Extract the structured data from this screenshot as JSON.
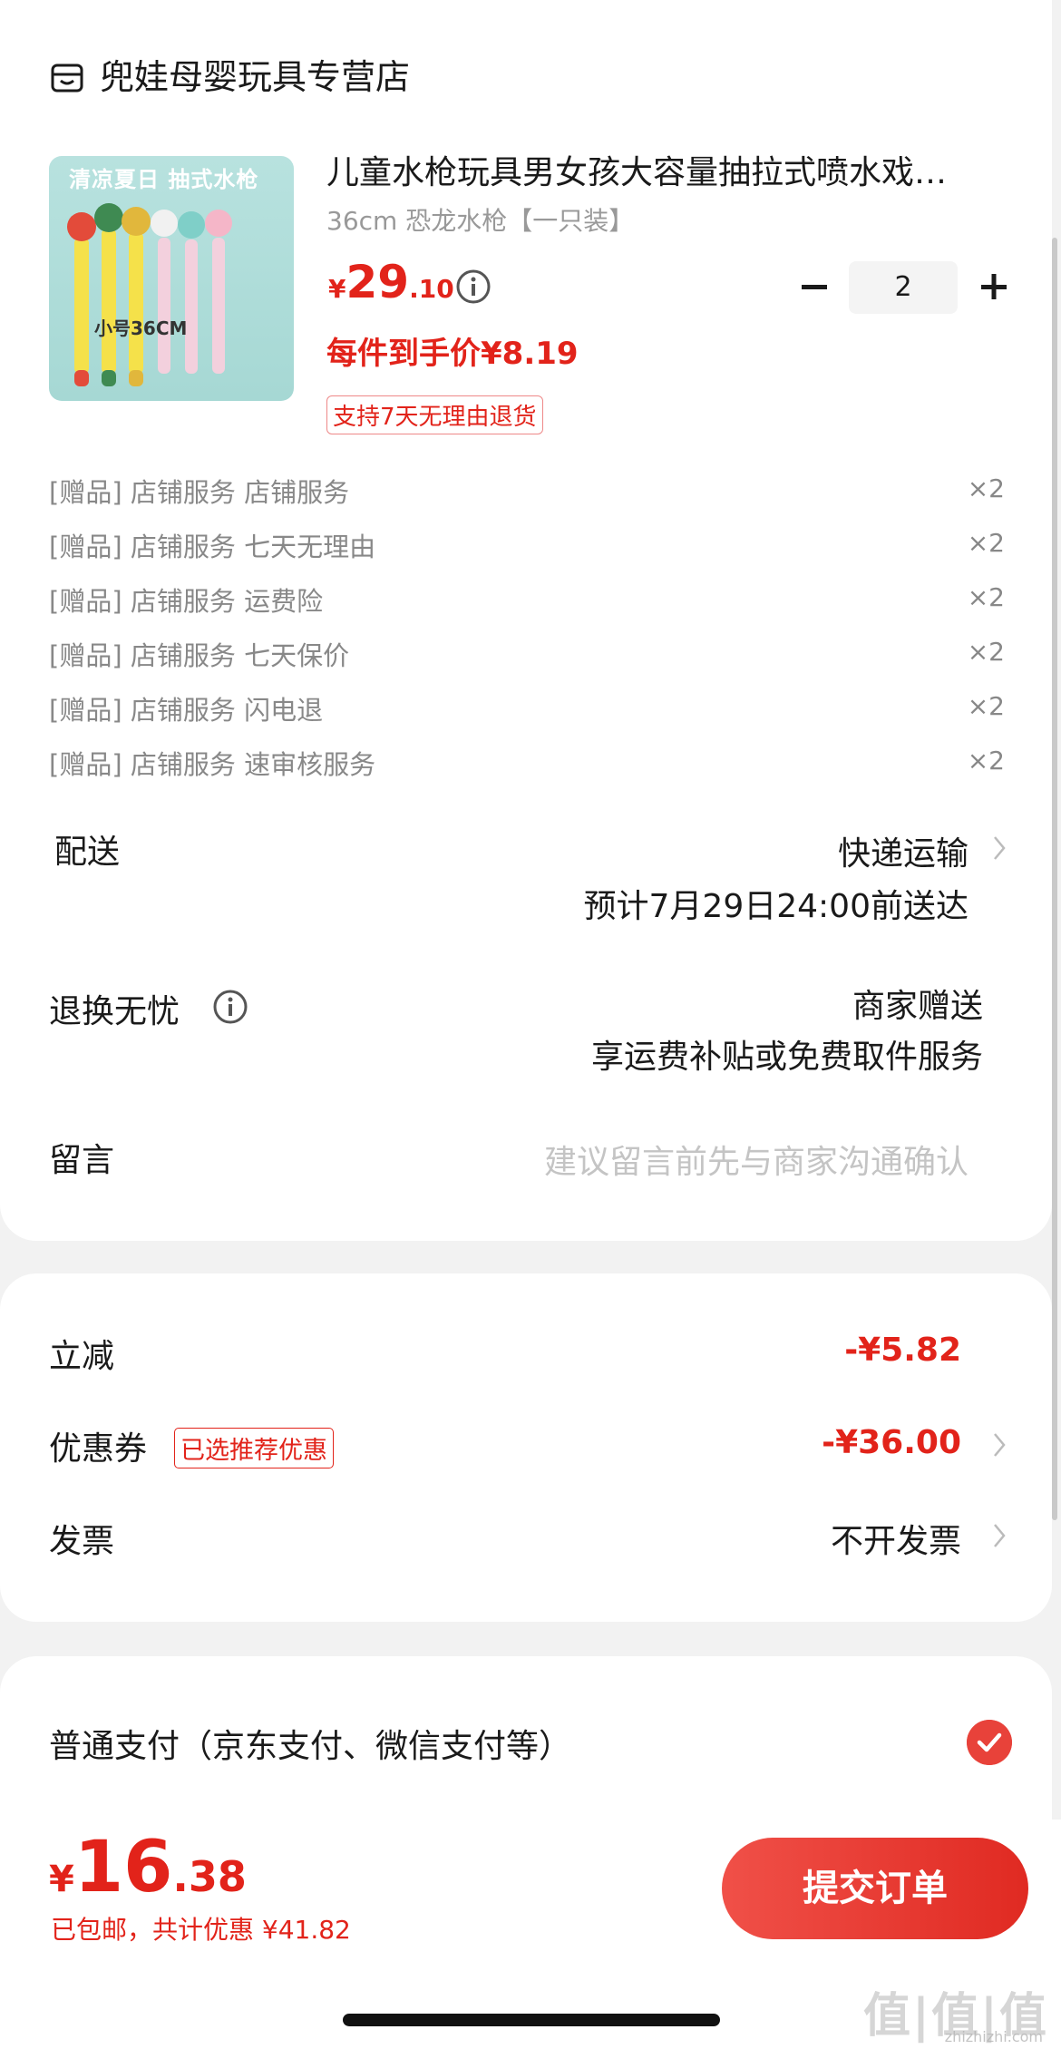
{
  "store": {
    "name": "兜娃母婴玩具专营店",
    "icon": "store-icon"
  },
  "product": {
    "image_banner": "清凉夏日 抽式水枪",
    "image_size_text": "小号36CM",
    "title": "儿童水枪玩具男女孩大容量抽拉式喷水戏…",
    "spec": "36cm 恐龙水枪【一只装】",
    "price_symbol": "¥",
    "price_int": "29",
    "price_dec": ".10",
    "unit_price": "每件到手价¥8.19",
    "return_tag": "支持7天无理由退货",
    "quantity": "2"
  },
  "gifts": [
    {
      "text": "[赠品] 店铺服务 店铺服务",
      "qty": "×2"
    },
    {
      "text": "[赠品] 店铺服务 七天无理由",
      "qty": "×2"
    },
    {
      "text": "[赠品] 店铺服务 运费险",
      "qty": "×2"
    },
    {
      "text": "[赠品] 店铺服务 七天保价",
      "qty": "×2"
    },
    {
      "text": "[赠品] 店铺服务 闪电退",
      "qty": "×2"
    },
    {
      "text": "[赠品] 店铺服务 速审核服务",
      "qty": "×2"
    }
  ],
  "delivery": {
    "label": "配送",
    "method": "快递运输",
    "eta": "预计7月29日24:00前送达"
  },
  "returns": {
    "label": "退换无忧",
    "line1": "商家赠送",
    "line2": "享运费补贴或免费取件服务"
  },
  "message": {
    "label": "留言",
    "placeholder": "建议留言前先与商家沟通确认"
  },
  "discounts": {
    "instant_label": "立减",
    "instant_value": "-¥5.82",
    "coupon_label": "优惠券",
    "coupon_tag": "已选推荐优惠",
    "coupon_value": "-¥36.00",
    "invoice_label": "发票",
    "invoice_value": "不开发票"
  },
  "payment": {
    "label": "普通支付（京东支付、微信支付等）"
  },
  "footer": {
    "total_symbol": "¥",
    "total_int": "16",
    "total_dec": ".38",
    "note": "已包邮，共计优惠 ¥41.82",
    "submit_label": "提交订单"
  },
  "watermark": {
    "main": "值|值|值",
    "sub": "zhizhizhi.com"
  },
  "colors": {
    "accent_red": "#e2231a",
    "button_red": "#e8423a",
    "background": "#f2f2f2"
  }
}
